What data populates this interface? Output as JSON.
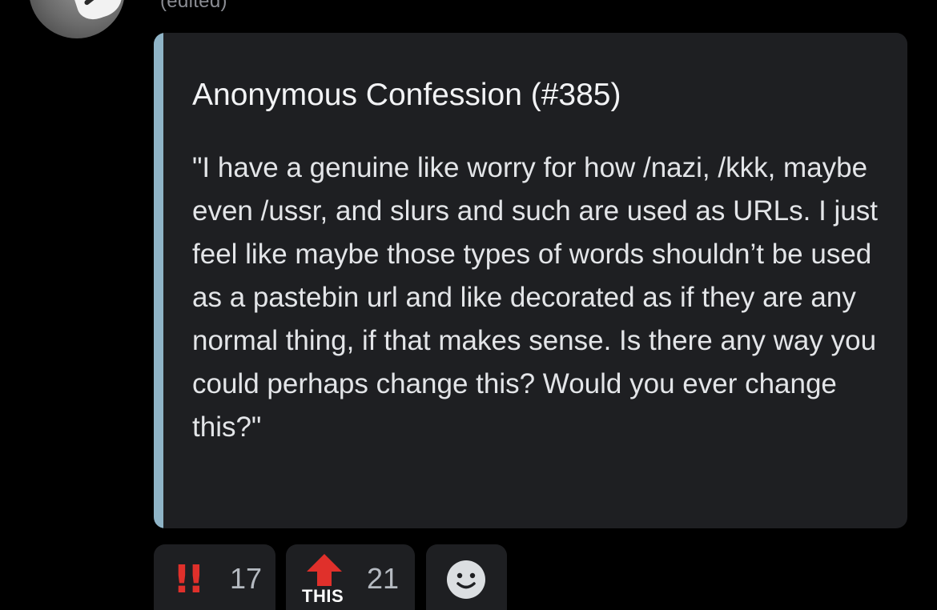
{
  "header": {
    "edited_label": "(edited)"
  },
  "embed": {
    "title": "Anonymous Confession (#385)",
    "body": "\"I have a genuine like worry for how /nazi, /kkk, maybe even /ussr, and slurs and such are used as URLs. I just feel like maybe those types of words shouldn’t be used as a pastebin url and like decorated as if they are any normal thing, if that makes sense. Is there any way you could perhaps change this? Would you ever change this?\"",
    "accent_color": "#8fb4c7"
  },
  "reactions": [
    {
      "emoji": "!!",
      "icon": "double-exclamation-icon",
      "count": "17"
    },
    {
      "emoji": "THIS",
      "icon": "this-up-arrow-icon",
      "count": "21"
    },
    {
      "icon": "add-reaction-smiley-icon"
    }
  ],
  "colors": {
    "background": "#000000",
    "embed_background": "#1e1f22",
    "exclamation_red": "#e0302b"
  }
}
